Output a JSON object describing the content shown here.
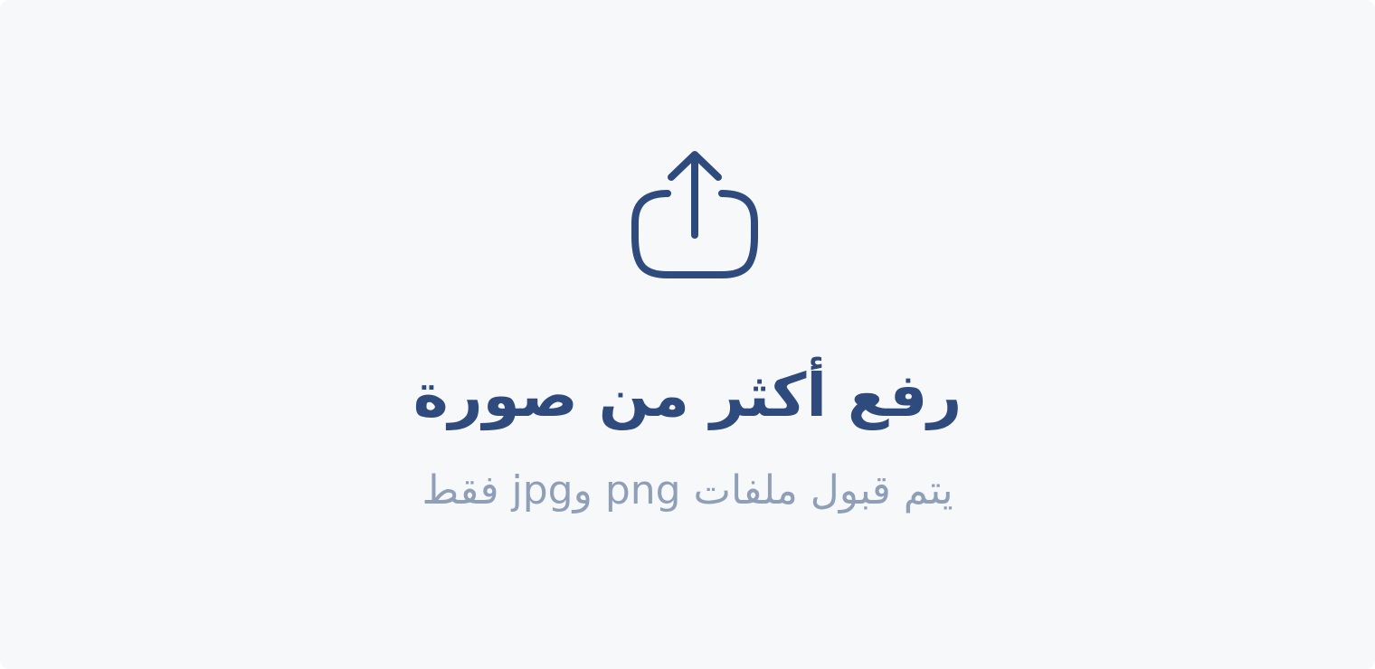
{
  "upload": {
    "icon": "upload-icon",
    "title": "رفع أكثر من صورة",
    "subtitle": "يتم قبول ملفات png وjpg فقط"
  },
  "colors": {
    "background": "#f7f8f9",
    "accent": "#2f4a7c",
    "muted_text": "#8f9fb8"
  }
}
